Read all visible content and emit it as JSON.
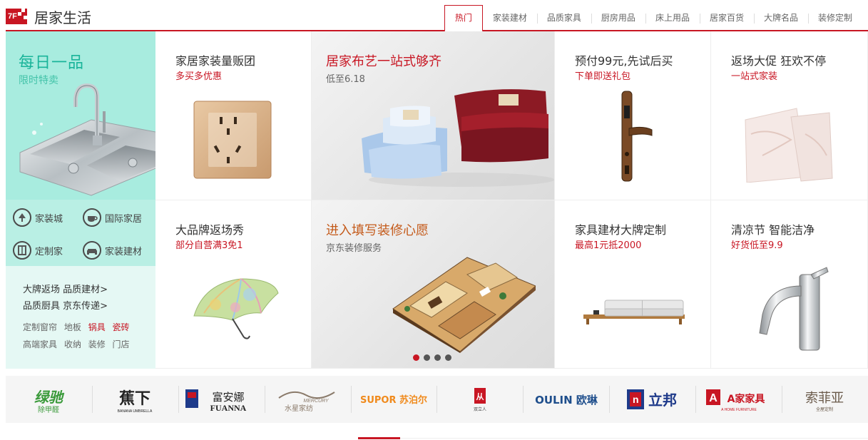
{
  "floor": {
    "badge": "7F",
    "title": "居家生活"
  },
  "tabs": [
    "热门",
    "家装建材",
    "品质家具",
    "厨房用品",
    "床上用品",
    "居家百货",
    "大牌名品",
    "装修定制"
  ],
  "promo": {
    "title": "每日一品",
    "subtitle": "限时特卖"
  },
  "quick_links": [
    {
      "label": "家装城",
      "icon": "lamp-icon"
    },
    {
      "label": "国际家居",
      "icon": "teacup-icon"
    },
    {
      "label": "定制家",
      "icon": "cabinet-icon"
    },
    {
      "label": "家装建材",
      "icon": "sofa-icon"
    }
  ],
  "text_links": {
    "row1": "大牌返场 品质建材>",
    "row2": "品质厨具 京东传递>",
    "row3": [
      "定制窗帘",
      "地板",
      "锅具",
      "瓷砖"
    ],
    "row4": [
      "高端家具",
      "收纳",
      "装修",
      "门店"
    ]
  },
  "cells": {
    "c1": {
      "title": "家居家装量贩团",
      "sub": "多买多优惠"
    },
    "c2": {
      "title": "居家布艺一站式够齐",
      "sub": "低至6.18"
    },
    "c3": {
      "title": "预付99元,先试后买",
      "sub": "下单即送礼包"
    },
    "c4": {
      "title": "返场大促 狂欢不停",
      "sub": "一站式家装"
    },
    "c5": {
      "title": "大品牌返场秀",
      "sub": "部分自营满3免1"
    },
    "c6": {
      "title": "进入填写装修心愿",
      "sub": "京东装修服务"
    },
    "c7": {
      "title": "家具建材大牌定制",
      "sub": "最高1元抵2000"
    },
    "c8": {
      "title": "清凉节 智能洁净",
      "sub": "好货低至9.9"
    }
  },
  "carousel": {
    "count": 4,
    "active": 1
  },
  "brands": [
    {
      "name": "绿驰",
      "tag": "除甲醛"
    },
    {
      "name": "蕉下",
      "tag": "BANANA UMBRELLA"
    },
    {
      "name": "富安娜",
      "tag": "FUANNA"
    },
    {
      "name": "水星家纺",
      "tag": "MERCURY"
    },
    {
      "name": "SUPOR 苏泊尔",
      "tag": ""
    },
    {
      "name": "双立人",
      "tag": ""
    },
    {
      "name": "OULIN 欧琳",
      "tag": ""
    },
    {
      "name": "立邦",
      "tag": ""
    },
    {
      "name": "A家家具",
      "tag": "A HOME FURNITURE"
    },
    {
      "name": "索菲亚",
      "tag": "全屋定制"
    }
  ],
  "colors": {
    "accent": "#c81623",
    "mint": "#a8ecdf",
    "promo_text": "#1ab49a"
  }
}
